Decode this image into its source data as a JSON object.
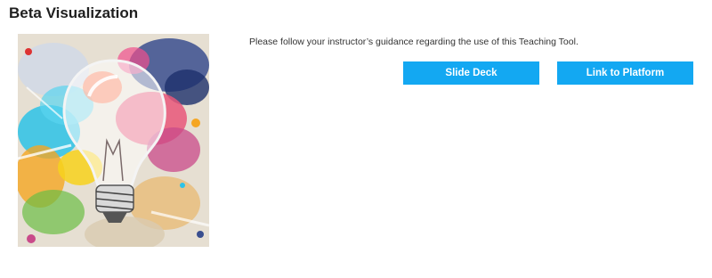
{
  "header": {
    "title": "Beta Visualization"
  },
  "hero": {
    "icon": "lightbulb-paint-splash-image"
  },
  "content": {
    "notice": "Please follow your instructor’s guidance regarding the use of this Teaching Tool.",
    "buttons": {
      "slide_deck": "Slide Deck",
      "platform": "Link to Platform"
    }
  },
  "colors": {
    "button_bg": "#13a8f2",
    "button_text": "#ffffff"
  }
}
